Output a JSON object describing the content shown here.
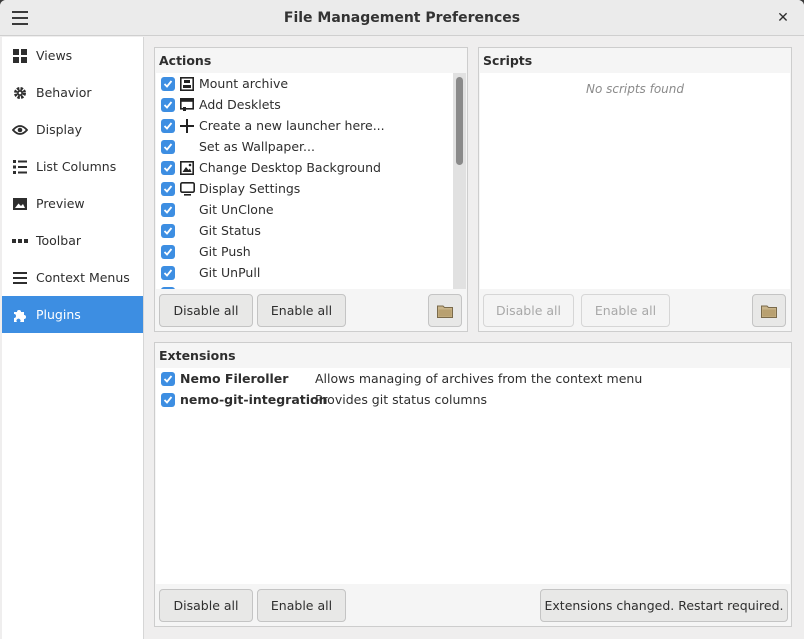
{
  "window": {
    "title": "File Management Preferences"
  },
  "sidebar": {
    "items": [
      {
        "label": "Views",
        "icon": "grid-icon"
      },
      {
        "label": "Behavior",
        "icon": "gear-icon"
      },
      {
        "label": "Display",
        "icon": "eye-icon"
      },
      {
        "label": "List Columns",
        "icon": "list-icon"
      },
      {
        "label": "Preview",
        "icon": "image-icon"
      },
      {
        "label": "Toolbar",
        "icon": "dots-icon"
      },
      {
        "label": "Context Menus",
        "icon": "menu-icon"
      },
      {
        "label": "Plugins",
        "icon": "puzzle-icon"
      }
    ],
    "active": "Plugins"
  },
  "actions": {
    "title": "Actions",
    "items": [
      {
        "label": "Mount archive",
        "icon": "archive-icon",
        "checked": true
      },
      {
        "label": "Add Desklets",
        "icon": "desklet-icon",
        "checked": true
      },
      {
        "label": "Create a new launcher here...",
        "icon": "plus-icon",
        "checked": true
      },
      {
        "label": "Set as Wallpaper...",
        "icon": "",
        "checked": true
      },
      {
        "label": "Change Desktop Background",
        "icon": "picture-icon",
        "checked": true
      },
      {
        "label": "Display Settings",
        "icon": "monitor-icon",
        "checked": true
      },
      {
        "label": "Git UnClone",
        "icon": "",
        "checked": true
      },
      {
        "label": "Git Status",
        "icon": "",
        "checked": true
      },
      {
        "label": "Git Push",
        "icon": "",
        "checked": true
      },
      {
        "label": "Git UnPull",
        "icon": "",
        "checked": true
      }
    ],
    "disable_all": "Disable all",
    "enable_all": "Enable all"
  },
  "scripts": {
    "title": "Scripts",
    "empty_text": "No scripts found",
    "disable_all": "Disable all",
    "enable_all": "Enable all"
  },
  "extensions": {
    "title": "Extensions",
    "items": [
      {
        "name": "Nemo Fileroller",
        "description": "Allows managing of archives from the context menu",
        "checked": true
      },
      {
        "name": "nemo-git-integration",
        "description": "Provides git status columns",
        "checked": true
      }
    ],
    "disable_all": "Disable all",
    "enable_all": "Enable all",
    "restart_notice": "Extensions changed.  Restart required."
  },
  "colors": {
    "accent": "#3d8ee2"
  }
}
